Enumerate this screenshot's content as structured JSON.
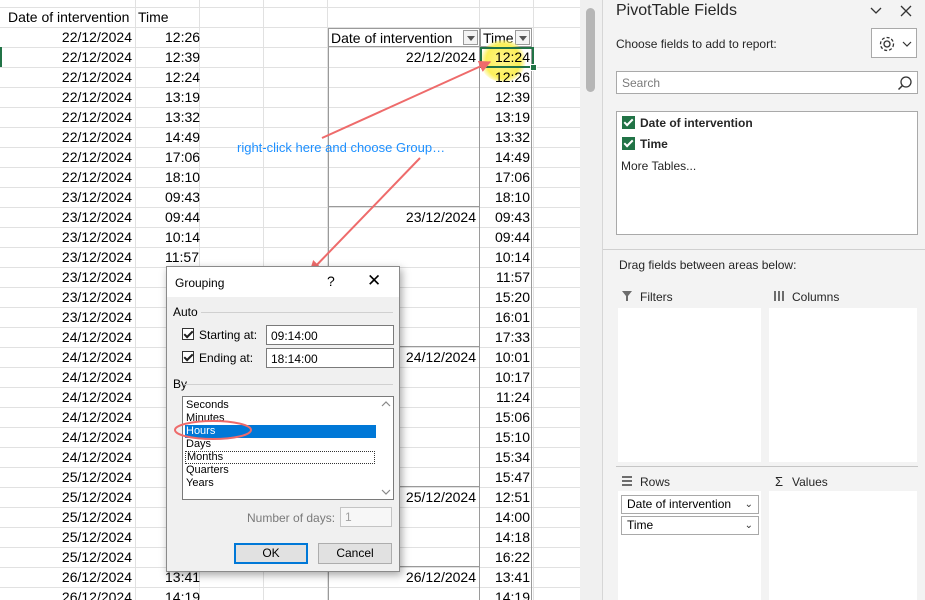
{
  "sheet": {
    "col_headers": [
      "Date of intervention",
      "Time"
    ],
    "rows": [
      {
        "date": "22/12/2024",
        "time": "12:26"
      },
      {
        "date": "22/12/2024",
        "time": "12:39"
      },
      {
        "date": "22/12/2024",
        "time": "12:24"
      },
      {
        "date": "22/12/2024",
        "time": "13:19"
      },
      {
        "date": "22/12/2024",
        "time": "13:32"
      },
      {
        "date": "22/12/2024",
        "time": "14:49"
      },
      {
        "date": "22/12/2024",
        "time": "17:06"
      },
      {
        "date": "22/12/2024",
        "time": "18:10"
      },
      {
        "date": "23/12/2024",
        "time": "09:43"
      },
      {
        "date": "23/12/2024",
        "time": "09:44"
      },
      {
        "date": "23/12/2024",
        "time": "10:14"
      },
      {
        "date": "23/12/2024",
        "time": "11:57"
      },
      {
        "date": "23/12/2024",
        "time": ""
      },
      {
        "date": "23/12/2024",
        "time": ""
      },
      {
        "date": "23/12/2024",
        "time": ""
      },
      {
        "date": "24/12/2024",
        "time": ""
      },
      {
        "date": "24/12/2024",
        "time": ""
      },
      {
        "date": "24/12/2024",
        "time": ""
      },
      {
        "date": "24/12/2024",
        "time": ""
      },
      {
        "date": "24/12/2024",
        "time": ""
      },
      {
        "date": "24/12/2024",
        "time": ""
      },
      {
        "date": "24/12/2024",
        "time": ""
      },
      {
        "date": "25/12/2024",
        "time": ""
      },
      {
        "date": "25/12/2024",
        "time": ""
      },
      {
        "date": "25/12/2024",
        "time": ""
      },
      {
        "date": "25/12/2024",
        "time": ""
      },
      {
        "date": "25/12/2024",
        "time": ""
      },
      {
        "date": "26/12/2024",
        "time": "13:41"
      },
      {
        "date": "26/12/2024",
        "time": "14:19"
      }
    ]
  },
  "pivot": {
    "header_date": "Date of intervention",
    "header_time": "Time",
    "groups": [
      {
        "date": "22/12/2024",
        "times": [
          "12:24",
          "12:26",
          "12:39",
          "13:19",
          "13:32",
          "14:49",
          "17:06",
          "18:10"
        ]
      },
      {
        "date": "23/12/2024",
        "times": [
          "09:43",
          "09:44",
          "10:14",
          "11:57",
          "15:20",
          "16:01",
          "17:33"
        ]
      },
      {
        "date": "24/12/2024",
        "times": [
          "10:01",
          "10:17",
          "11:24",
          "15:06",
          "15:10",
          "15:34",
          "15:47"
        ]
      },
      {
        "date": "25/12/2024",
        "times": [
          "12:51",
          "14:00",
          "14:18",
          "16:22"
        ]
      },
      {
        "date": "26/12/2024",
        "times": [
          "13:41",
          "14:19"
        ]
      }
    ]
  },
  "annotation": {
    "text": "right-click here and choose Group…",
    "color": "#1e90ff",
    "arrow_color": "#ee6b6b"
  },
  "dialog": {
    "title": "Grouping",
    "help": "?",
    "close": "✕",
    "auto_label": "Auto",
    "starting_label": "Starting at:",
    "starting_value": "09:14:00",
    "ending_label": "Ending at:",
    "ending_value": "18:14:00",
    "by_label": "By",
    "by_items": [
      "Seconds",
      "Minutes",
      "Hours",
      "Days",
      "Months",
      "Quarters",
      "Years"
    ],
    "selected_item": "Hours",
    "days_label": "Number of days:",
    "days_value": "1",
    "ok": "OK",
    "cancel": "Cancel"
  },
  "pane": {
    "title": "PivotTable Fields",
    "choose_text": "Choose fields to add to report:",
    "search_placeholder": "Search",
    "fields": [
      "Date of intervention",
      "Time"
    ],
    "more_tables": "More Tables...",
    "drag_text": "Drag fields between areas below:",
    "filters": "Filters",
    "columns": "Columns",
    "rows": "Rows",
    "values": "Values",
    "row_pills": [
      "Date of intervention",
      "Time"
    ]
  },
  "colors": {
    "excel_green": "#217346",
    "selection_blue": "#0078d7",
    "highlight_yellow": "#fbf05a"
  }
}
